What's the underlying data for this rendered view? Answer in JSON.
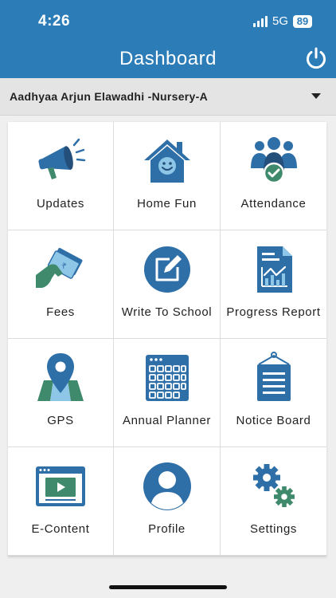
{
  "status_bar": {
    "time": "4:26",
    "network": "5G",
    "battery": "89"
  },
  "header": {
    "title": "Dashboard",
    "power_icon": "power-icon"
  },
  "student_selector": {
    "selected": "Aadhyaa Arjun Elawadhi -Nursery-A"
  },
  "colors": {
    "header": "#2c7cb8",
    "icon_blue": "#2f6fa8",
    "icon_green": "#3f8a6d"
  },
  "tiles": [
    {
      "label": "Updates",
      "icon": "megaphone-icon"
    },
    {
      "label": "Home Fun",
      "icon": "house-smile-icon"
    },
    {
      "label": "Attendance",
      "icon": "group-check-icon"
    },
    {
      "label": "Fees",
      "icon": "money-hand-icon"
    },
    {
      "label": "Write To School",
      "icon": "edit-circle-icon"
    },
    {
      "label": "Progress Report",
      "icon": "report-chart-icon"
    },
    {
      "label": "GPS",
      "icon": "map-pin-icon"
    },
    {
      "label": "Annual Planner",
      "icon": "calendar-icon"
    },
    {
      "label": "Notice Board",
      "icon": "notice-board-icon"
    },
    {
      "label": "E-Content",
      "icon": "video-screen-icon"
    },
    {
      "label": "Profile",
      "icon": "user-circle-icon"
    },
    {
      "label": "Settings",
      "icon": "gears-icon"
    }
  ]
}
